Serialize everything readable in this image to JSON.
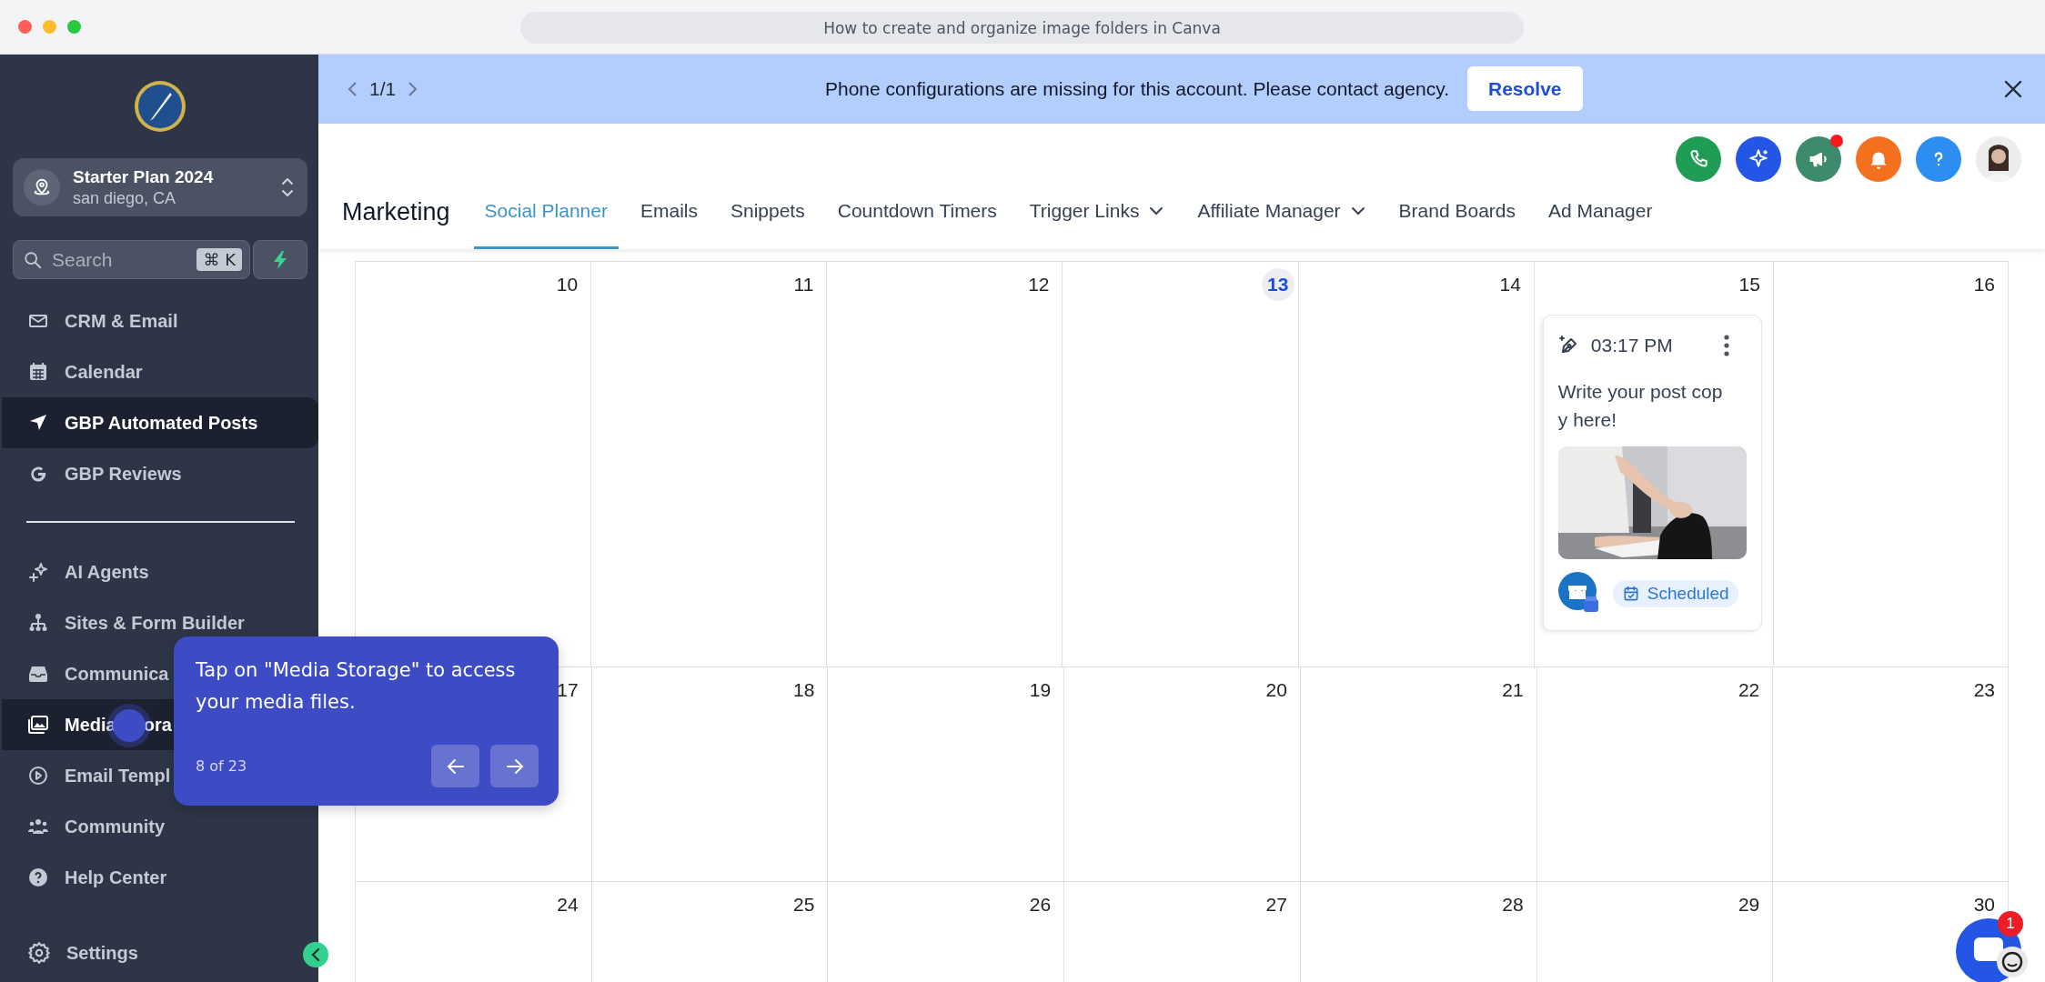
{
  "browser": {
    "title": "How to create and organize image folders in Canva"
  },
  "sidebar": {
    "account": {
      "name": "Starter Plan 2024",
      "location": "san diego, CA"
    },
    "search": {
      "placeholder": "Search",
      "shortcut": "⌘ K"
    },
    "groups": [
      {
        "items": [
          {
            "label": "CRM & Email",
            "selected": false
          },
          {
            "label": "Calendar",
            "selected": false
          },
          {
            "label": "GBP Automated Posts",
            "selected": true
          },
          {
            "label": "GBP Reviews",
            "selected": false
          }
        ]
      },
      {
        "items": [
          {
            "label": "AI Agents",
            "selected": false
          },
          {
            "label": "Sites & Form Builder",
            "selected": false
          },
          {
            "label": "Communica",
            "selected": false
          },
          {
            "label": "Media",
            "label_tail": "ora",
            "selected": true
          },
          {
            "label": "Email Templ",
            "selected": false
          },
          {
            "label": "Community",
            "selected": false
          },
          {
            "label": "Help Center",
            "selected": false
          }
        ]
      }
    ],
    "settings": {
      "label": "Settings"
    }
  },
  "banner": {
    "pager": "1/1",
    "message": "Phone configurations are missing for this account. Please contact agency.",
    "action": "Resolve"
  },
  "header": {
    "announcements_unread": true,
    "section": "Marketing",
    "tabs": [
      {
        "label": "Social Planner",
        "selected": true,
        "dropdown": false
      },
      {
        "label": "Emails",
        "selected": false,
        "dropdown": false
      },
      {
        "label": "Snippets",
        "selected": false,
        "dropdown": false
      },
      {
        "label": "Countdown Timers",
        "selected": false,
        "dropdown": false
      },
      {
        "label": "Trigger Links",
        "selected": false,
        "dropdown": true
      },
      {
        "label": "Affiliate Manager",
        "selected": false,
        "dropdown": true
      },
      {
        "label": "Brand Boards",
        "selected": false,
        "dropdown": false
      },
      {
        "label": "Ad Manager",
        "selected": false,
        "dropdown": false
      }
    ]
  },
  "calendar": {
    "weeks": [
      {
        "days": [
          {
            "date": "10",
            "today": false
          },
          {
            "date": "11",
            "today": false
          },
          {
            "date": "12",
            "today": false
          },
          {
            "date": "13",
            "today": true
          },
          {
            "date": "14",
            "today": false
          },
          {
            "date": "15",
            "today": false,
            "posts": [
              {
                "time": "03:17 PM",
                "text": "Write your post copy here!",
                "status": "Scheduled"
              }
            ]
          },
          {
            "date": "16",
            "today": false
          }
        ]
      },
      {
        "days": [
          {
            "date": "17",
            "today": false
          },
          {
            "date": "18",
            "today": false
          },
          {
            "date": "19",
            "today": false
          },
          {
            "date": "20",
            "today": false
          },
          {
            "date": "21",
            "today": false
          },
          {
            "date": "22",
            "today": false
          },
          {
            "date": "23",
            "today": false
          }
        ]
      },
      {
        "days": [
          {
            "date": "24",
            "today": false
          },
          {
            "date": "25",
            "today": false
          },
          {
            "date": "26",
            "today": false
          },
          {
            "date": "27",
            "today": false
          },
          {
            "date": "28",
            "today": false
          },
          {
            "date": "29",
            "today": false
          },
          {
            "date": "30",
            "today": false
          }
        ]
      }
    ]
  },
  "tour": {
    "text": "Tap on \"Media Storage\" to access your media files.",
    "step": "8 of 23"
  },
  "chat": {
    "badge": "1"
  }
}
